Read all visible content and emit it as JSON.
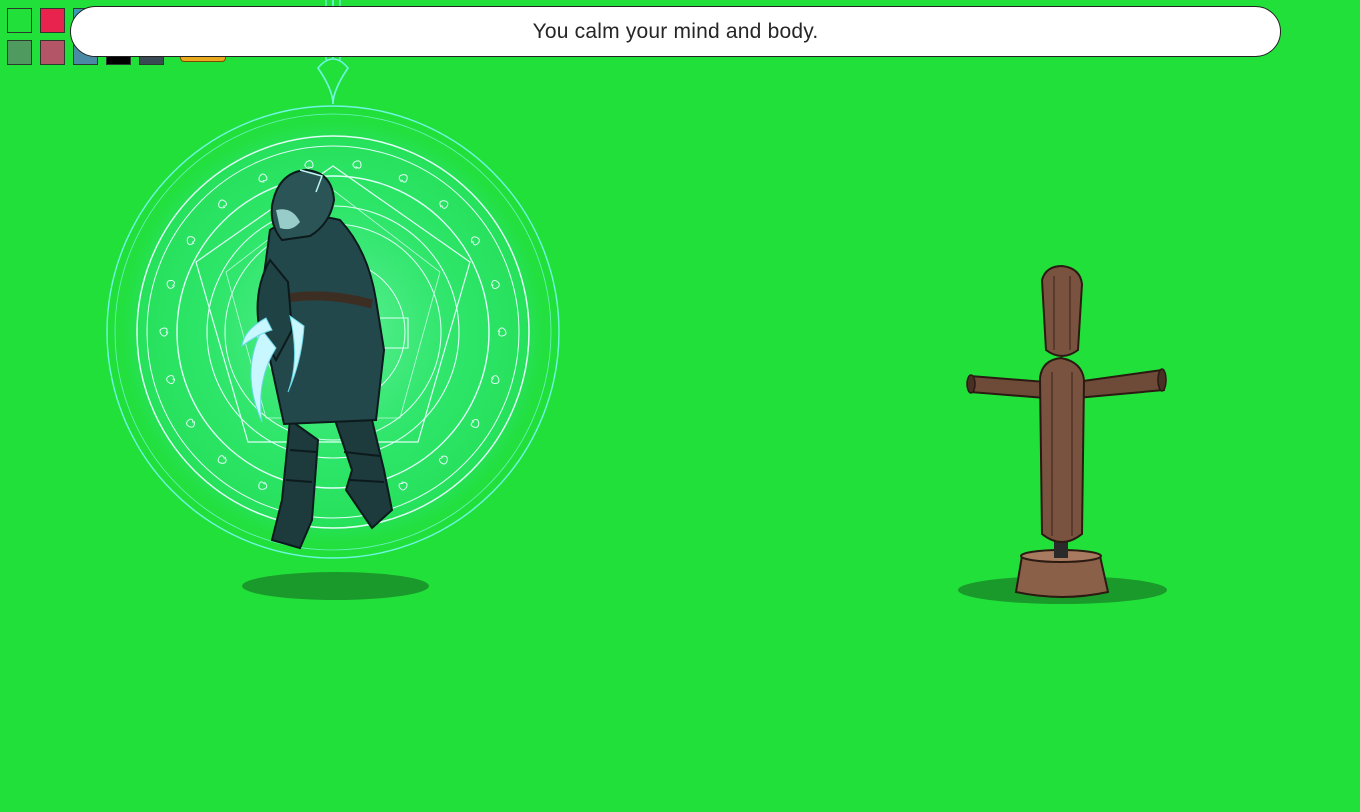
{
  "message": {
    "text": "You calm your mind and body."
  },
  "palette": {
    "row1": [
      {
        "name": "swatch-green",
        "color": "#22e03a"
      },
      {
        "name": "swatch-red",
        "color": "#e8234d"
      },
      {
        "name": "swatch-teal",
        "color": "#3a9cb4"
      }
    ],
    "row2": [
      {
        "name": "swatch-sage",
        "color": "#4f9a5f"
      },
      {
        "name": "swatch-rose",
        "color": "#b35467"
      },
      {
        "name": "swatch-steel-blue",
        "color": "#4a8aa4"
      },
      {
        "name": "swatch-black",
        "color": "#000000"
      },
      {
        "name": "swatch-slate",
        "color": "#3a4a55"
      }
    ]
  },
  "scene": {
    "background_color": "#22e03a",
    "player": {
      "name": "hooded-rogue-character",
      "aura_color": "#5ff5d5"
    },
    "target": {
      "name": "training-dummy"
    }
  }
}
